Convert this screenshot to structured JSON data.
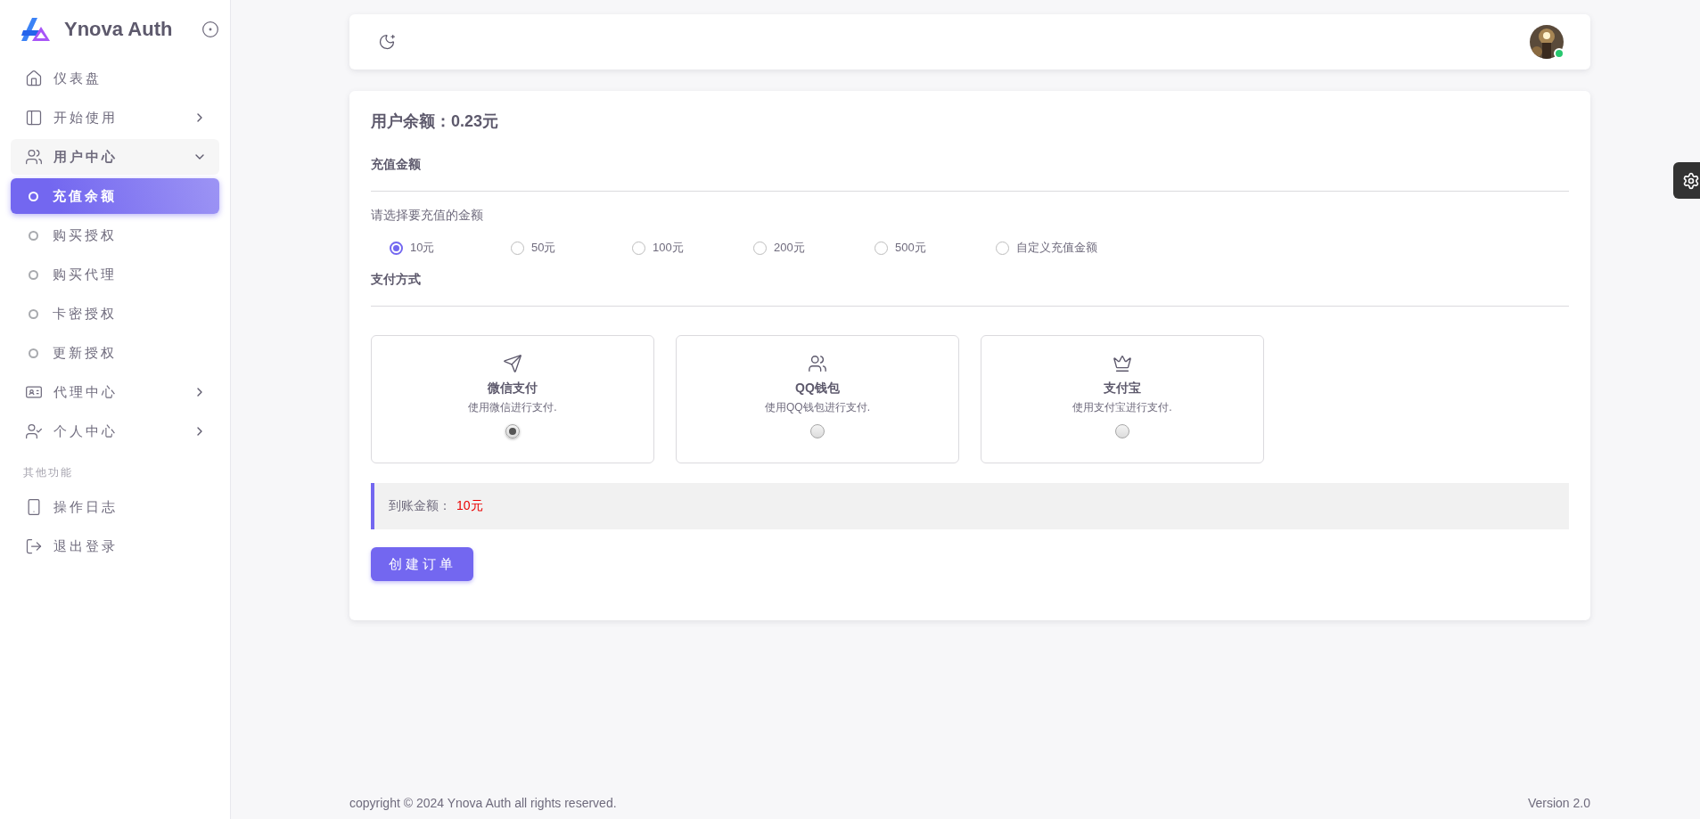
{
  "sidebar": {
    "brand": "Ynova Auth",
    "menu": [
      {
        "label": "仪表盘",
        "selected": false
      },
      {
        "label": "开始使用",
        "selected": false,
        "expanded": false
      },
      {
        "label": "用户中心",
        "selected": false,
        "expanded": true,
        "children": [
          {
            "label": "充值余额",
            "selected": true
          },
          {
            "label": "购买授权",
            "selected": false
          },
          {
            "label": "购买代理",
            "selected": false
          },
          {
            "label": "卡密授权",
            "selected": false
          },
          {
            "label": "更新授权",
            "selected": false
          }
        ]
      },
      {
        "label": "代理中心",
        "selected": false,
        "expanded": false
      },
      {
        "label": "个人中心",
        "selected": false,
        "expanded": false
      }
    ],
    "other": {
      "title": "其他功能",
      "items": [
        {
          "label": "操作日志",
          "selected": false
        },
        {
          "label": "退出登录",
          "selected": false
        }
      ]
    }
  },
  "topbar": {
    "avatar": {
      "online": true
    }
  },
  "balance": "用户余额：0.23元",
  "recharge": {
    "heading": "充值金额",
    "prompt": "请选择要充值的金额",
    "options": [
      {
        "label": "10元",
        "selected": true
      },
      {
        "label": "50元",
        "selected": false
      },
      {
        "label": "100元",
        "selected": false
      },
      {
        "label": "200元",
        "selected": false
      },
      {
        "label": "500元",
        "selected": false
      },
      {
        "label": "自定义充值金额",
        "selected": false
      }
    ]
  },
  "payment": {
    "heading": "支付方式",
    "methods": [
      {
        "name": "微信支付",
        "description": "使用微信进行支付.",
        "selected": true
      },
      {
        "name": "QQ钱包",
        "description": "使用QQ钱包进行支付.",
        "selected": false
      },
      {
        "name": "支付宝",
        "description": "使用支付宝进行支付.",
        "selected": false
      }
    ]
  },
  "arrival": {
    "label": "到账金额：",
    "value": "10元"
  },
  "submit": "创建订单",
  "footer": {
    "copyright": "copyright © 2024 Ynova Auth all rights reserved.",
    "version": "Version 2.0"
  }
}
